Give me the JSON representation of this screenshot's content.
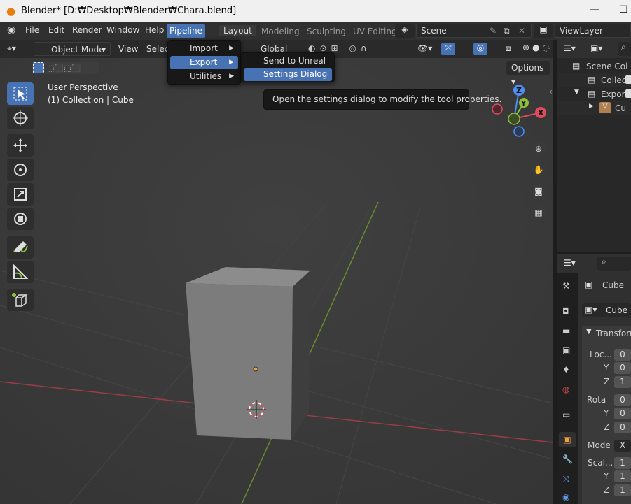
{
  "window": {
    "title": "Blender* [D:₩Desktop₩Blender₩Chara.blend]"
  },
  "menubar": {
    "items": [
      "File",
      "Edit",
      "Render",
      "Window",
      "Help"
    ],
    "pipeline": "Pipeline"
  },
  "workspaces": [
    {
      "label": "Layout",
      "active": true
    },
    {
      "label": "Modeling"
    },
    {
      "label": "Sculpting"
    },
    {
      "label": "UV Editing"
    }
  ],
  "scene": {
    "value": "Scene"
  },
  "view_layer": {
    "value": "ViewLayer"
  },
  "viewport_header": {
    "mode": "Object Mode",
    "view": "View",
    "select": "Select",
    "orientation": "Global",
    "options": "Options"
  },
  "viewport_text": {
    "perspective": "User Perspective",
    "collection": "(1) Collection | Cube"
  },
  "pipeline_menu": {
    "items": [
      "Import",
      "Export",
      "Utilities"
    ],
    "highlighted": "Export"
  },
  "export_submenu": {
    "items": [
      "Send to Unreal",
      "Settings Dialog"
    ],
    "highlighted": "Settings Dialog"
  },
  "tooltip": "Open the settings dialog to modify the tool properties.",
  "gizmo": {
    "x": "X",
    "y": "Y",
    "z": "Z"
  },
  "outliner": {
    "items": [
      "Scene Col",
      "Collec",
      "Export",
      "Cu"
    ]
  },
  "properties": {
    "object_name": "Cube",
    "data_name": "Cube",
    "panel": "Transform",
    "location": {
      "label": "Loc...",
      "x": "0",
      "y": "0",
      "z": "1"
    },
    "rotation": {
      "label": "Rota",
      "x": "0",
      "y": "0",
      "z": "0"
    },
    "mode": {
      "label": "Mode",
      "value": "X"
    },
    "scale": {
      "label": "Scal...",
      "x": "1",
      "y": "1",
      "z": "1"
    },
    "axis": {
      "y": "Y",
      "z": "Z"
    }
  },
  "colors": {
    "accent": "#4772b3",
    "x_axis": "#e04a5f",
    "y_axis": "#8bbf3d",
    "z_axis": "#4f8ff0"
  }
}
